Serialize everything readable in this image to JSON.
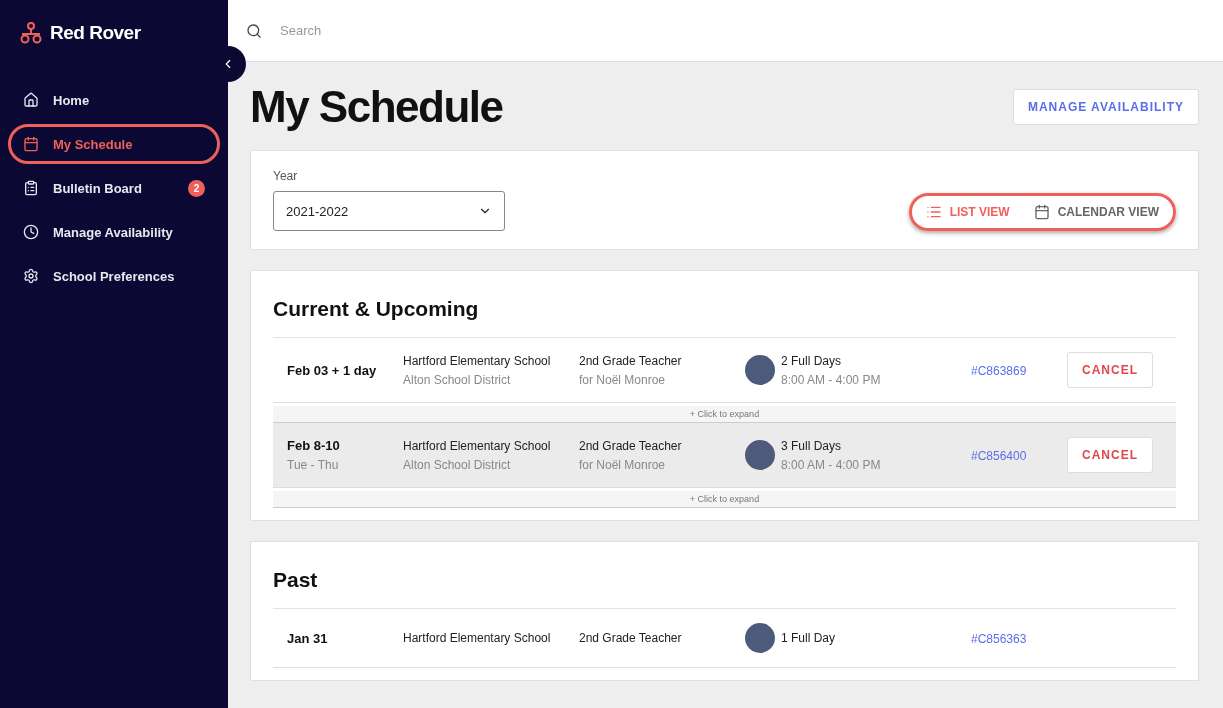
{
  "brand": {
    "name": "Red Rover"
  },
  "sidebar": {
    "items": [
      {
        "label": "Home",
        "selected": false
      },
      {
        "label": "My Schedule",
        "selected": true
      },
      {
        "label": "Bulletin Board",
        "selected": false,
        "badge": "2"
      },
      {
        "label": "Manage Availability",
        "selected": false
      },
      {
        "label": "School Preferences",
        "selected": false
      }
    ]
  },
  "search": {
    "placeholder": "Search"
  },
  "page": {
    "title": "My Schedule",
    "action": "MANAGE AVAILABILITY"
  },
  "filters": {
    "year_label": "Year",
    "year_value": "2021-2022",
    "views": [
      {
        "label": "LIST VIEW",
        "selected": true
      },
      {
        "label": "CALENDAR VIEW",
        "selected": false
      }
    ]
  },
  "sections": [
    {
      "title": "Current & Upcoming",
      "rows": [
        {
          "date": "Feb 03 + 1 day",
          "days": null,
          "school": "Hartford Elementary School",
          "district": "Alton School District",
          "position": "2nd Grade Teacher",
          "for": "for Noël Monroe",
          "duration": "2 Full Days",
          "time": "8:00 AM - 4:00 PM",
          "code": "#C863869",
          "action": "CANCEL",
          "expand": "+ Click to expand",
          "highlighted": false
        },
        {
          "date": "Feb 8-10",
          "days": "Tue - Thu",
          "school": "Hartford Elementary School",
          "district": "Alton School District",
          "position": "2nd Grade Teacher",
          "for": "for Noël Monroe",
          "duration": "3 Full Days",
          "time": "8:00 AM - 4:00 PM",
          "code": "#C856400",
          "action": "CANCEL",
          "expand": "+ Click to expand",
          "highlighted": true
        }
      ]
    },
    {
      "title": "Past",
      "rows": [
        {
          "date": "Jan 31",
          "school": "Hartford Elementary School",
          "position": "2nd Grade Teacher",
          "duration": "1 Full Day",
          "code": "#C856363",
          "highlighted": false
        }
      ]
    }
  ]
}
